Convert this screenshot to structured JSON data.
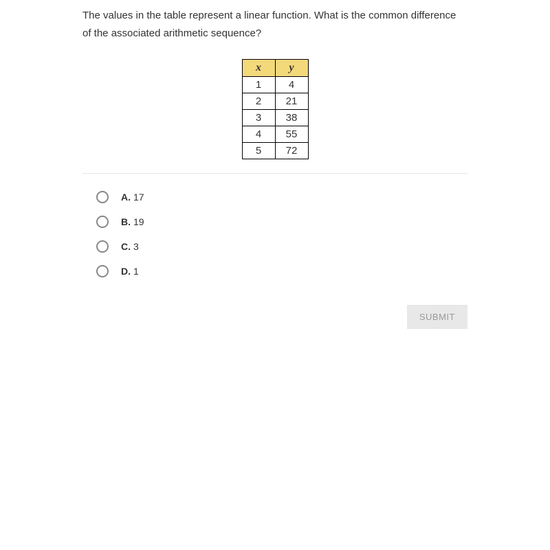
{
  "question": "The values in the table represent a linear function. What is the common difference of the associated arithmetic sequence?",
  "table": {
    "headers": [
      "x",
      "y"
    ],
    "rows": [
      [
        "1",
        "4"
      ],
      [
        "2",
        "21"
      ],
      [
        "3",
        "38"
      ],
      [
        "4",
        "55"
      ],
      [
        "5",
        "72"
      ]
    ]
  },
  "options": [
    {
      "letter": "A.",
      "text": "17"
    },
    {
      "letter": "B.",
      "text": "19"
    },
    {
      "letter": "C.",
      "text": "3"
    },
    {
      "letter": "D.",
      "text": "1"
    }
  ],
  "submit_label": "SUBMIT"
}
